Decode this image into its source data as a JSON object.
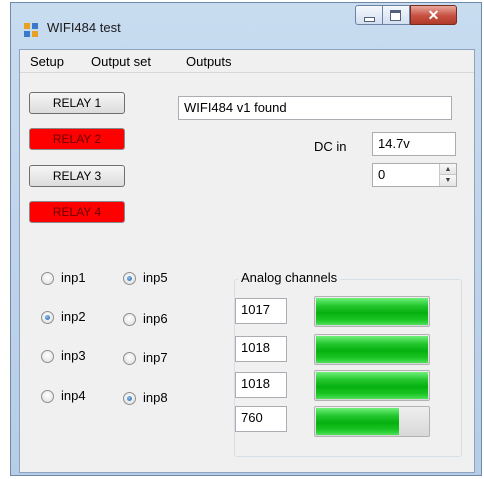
{
  "window": {
    "title": "WIFI484 test"
  },
  "menu": {
    "setup": "Setup",
    "output_set": "Output set",
    "outputs": "Outputs"
  },
  "relays": [
    {
      "label": "RELAY 1",
      "on": false
    },
    {
      "label": "RELAY 2",
      "on": true
    },
    {
      "label": "RELAY 3",
      "on": false
    },
    {
      "label": "RELAY 4",
      "on": true
    }
  ],
  "status": {
    "text": "WIFI484 v1 found"
  },
  "dc_in": {
    "label": "DC in",
    "value": "14.7v"
  },
  "numeric": {
    "value": "0"
  },
  "inputs": {
    "inp1": {
      "label": "inp1",
      "checked": false
    },
    "inp2": {
      "label": "inp2",
      "checked": true
    },
    "inp3": {
      "label": "inp3",
      "checked": false
    },
    "inp4": {
      "label": "inp4",
      "checked": false
    },
    "inp5": {
      "label": "inp5",
      "checked": true
    },
    "inp6": {
      "label": "inp6",
      "checked": false
    },
    "inp7": {
      "label": "inp7",
      "checked": false
    },
    "inp8": {
      "label": "inp8",
      "checked": true
    }
  },
  "analog": {
    "title": "Analog channels",
    "channels": [
      {
        "value": "1017",
        "level": 1.0
      },
      {
        "value": "1018",
        "level": 1.0
      },
      {
        "value": "1018",
        "level": 1.0
      },
      {
        "value": "760",
        "level": 0.74
      }
    ]
  },
  "colors": {
    "relay_on": "#ff0000",
    "bar_fill": "#06b010"
  }
}
